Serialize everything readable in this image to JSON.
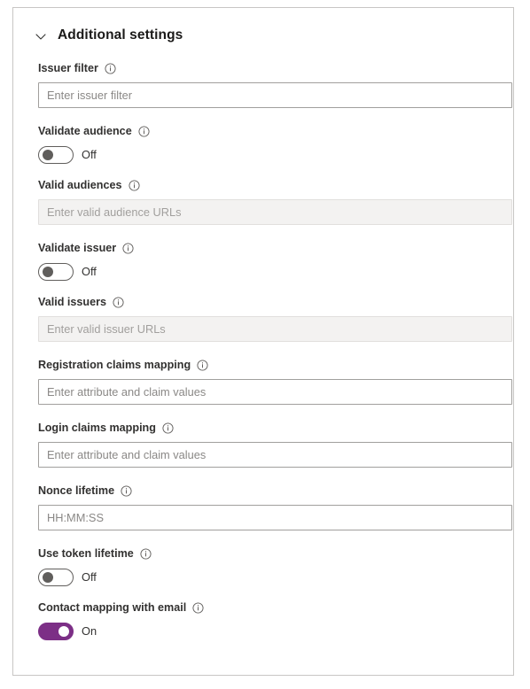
{
  "panel": {
    "header": {
      "title": "Additional settings",
      "chevron_icon": "chevron-down-icon",
      "expanded": true
    },
    "info_icon": "info-circle-icon",
    "accent_color": "#7c2f86",
    "border_color": "#c8c6c4",
    "fields": [
      {
        "id": "issuer-filter",
        "type": "text",
        "label": "Issuer filter",
        "value": "",
        "placeholder": "Enter issuer filter",
        "disabled": false,
        "has_info": true
      },
      {
        "id": "validate-audience",
        "type": "toggle",
        "label": "Validate audience",
        "state_label": "Off",
        "on": false,
        "has_info": true
      },
      {
        "id": "valid-audiences",
        "type": "text",
        "label": "Valid audiences",
        "value": "",
        "placeholder": "Enter valid audience URLs",
        "disabled": true,
        "has_info": true
      },
      {
        "id": "validate-issuer",
        "type": "toggle",
        "label": "Validate issuer",
        "state_label": "Off",
        "on": false,
        "has_info": true
      },
      {
        "id": "valid-issuers",
        "type": "text",
        "label": "Valid issuers",
        "value": "",
        "placeholder": "Enter valid issuer URLs",
        "disabled": true,
        "has_info": true
      },
      {
        "id": "registration-claims-mapping",
        "type": "text",
        "label": "Registration claims mapping",
        "value": "",
        "placeholder": "Enter attribute and claim values",
        "disabled": false,
        "has_info": true
      },
      {
        "id": "login-claims-mapping",
        "type": "text",
        "label": "Login claims mapping",
        "value": "",
        "placeholder": "Enter attribute and claim values",
        "disabled": false,
        "has_info": true
      },
      {
        "id": "nonce-lifetime",
        "type": "text",
        "label": "Nonce lifetime",
        "value": "",
        "placeholder": "HH:MM:SS",
        "disabled": false,
        "has_info": true
      },
      {
        "id": "use-token-lifetime",
        "type": "toggle",
        "label": "Use token lifetime",
        "state_label": "Off",
        "on": false,
        "has_info": true
      },
      {
        "id": "contact-mapping-with-email",
        "type": "toggle",
        "label": "Contact mapping with email",
        "state_label": "On",
        "on": true,
        "has_info": true
      }
    ]
  }
}
